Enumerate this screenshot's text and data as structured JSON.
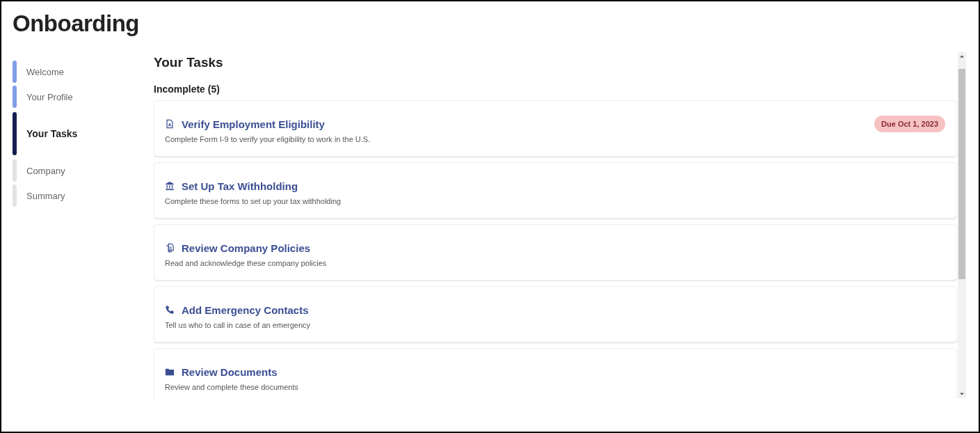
{
  "page": {
    "title": "Onboarding"
  },
  "sidebar": {
    "items": [
      {
        "label": "Welcome",
        "completed": true,
        "selected": false
      },
      {
        "label": "Your Profile",
        "completed": true,
        "selected": false
      },
      {
        "label": "Your Tasks",
        "completed": false,
        "selected": true
      },
      {
        "label": "Company",
        "completed": false,
        "selected": false
      },
      {
        "label": "Summary",
        "completed": false,
        "selected": false
      }
    ]
  },
  "main": {
    "heading": "Your Tasks",
    "section": "Incomplete (5)",
    "tasks": [
      {
        "kind": "pdf",
        "title": "Verify Employment Eligibility",
        "description": "Complete Form I-9 to verify your eligibility to work in the U.S.",
        "due": "Due Oct 1, 2023"
      },
      {
        "kind": "bank",
        "title": "Set Up Tax Withholding",
        "description": "Complete these forms to set up your tax withholding"
      },
      {
        "kind": "copy",
        "title": "Review Company Policies",
        "description": "Read and acknowledge these company policies"
      },
      {
        "kind": "phone",
        "title": "Add Emergency Contacts",
        "description": "Tell us who to call in case of an emergency"
      },
      {
        "kind": "folder",
        "title": "Review Documents",
        "description": "Review and complete these documents"
      }
    ]
  }
}
